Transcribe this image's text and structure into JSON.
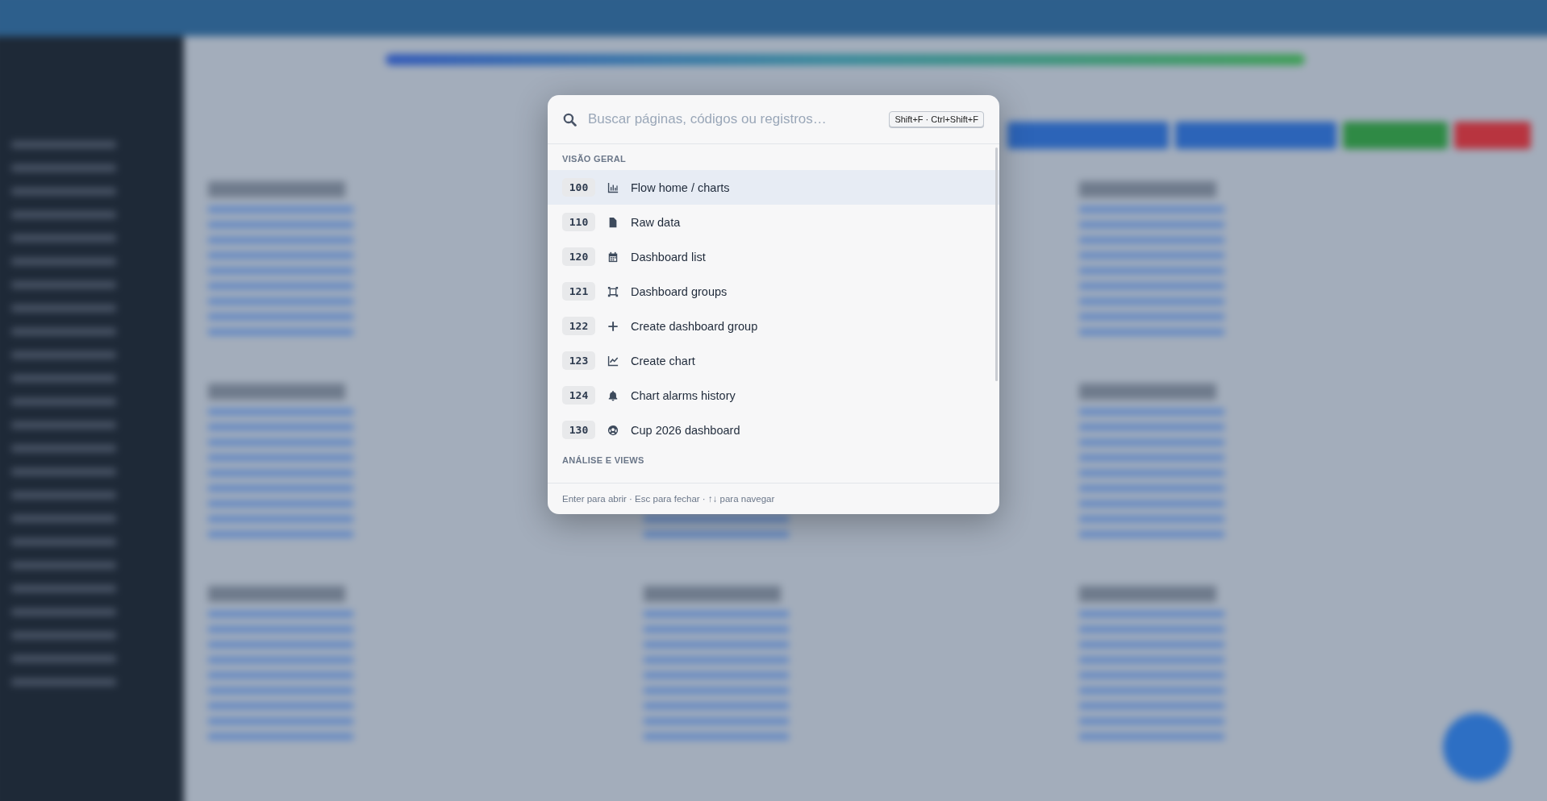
{
  "search": {
    "placeholder": "Buscar páginas, códigos ou registros…",
    "shortcut": "Shift+F · Ctrl+Shift+F"
  },
  "sections": [
    {
      "title": "VISÃO GERAL",
      "items": [
        {
          "code": "100",
          "label": "Flow home / charts",
          "selected": true
        },
        {
          "code": "110",
          "label": "Raw data",
          "selected": false
        },
        {
          "code": "120",
          "label": "Dashboard list",
          "selected": false
        },
        {
          "code": "121",
          "label": "Dashboard groups",
          "selected": false
        },
        {
          "code": "122",
          "label": "Create dashboard group",
          "selected": false
        },
        {
          "code": "123",
          "label": "Create chart",
          "selected": false
        },
        {
          "code": "124",
          "label": "Chart alarms history",
          "selected": false
        },
        {
          "code": "130",
          "label": "Cup 2026 dashboard",
          "selected": false
        }
      ]
    },
    {
      "title": "ANÁLISE E VIEWS"
    }
  ],
  "footer": "Enter para abrir · Esc para fechar · ↑↓ para navegar"
}
